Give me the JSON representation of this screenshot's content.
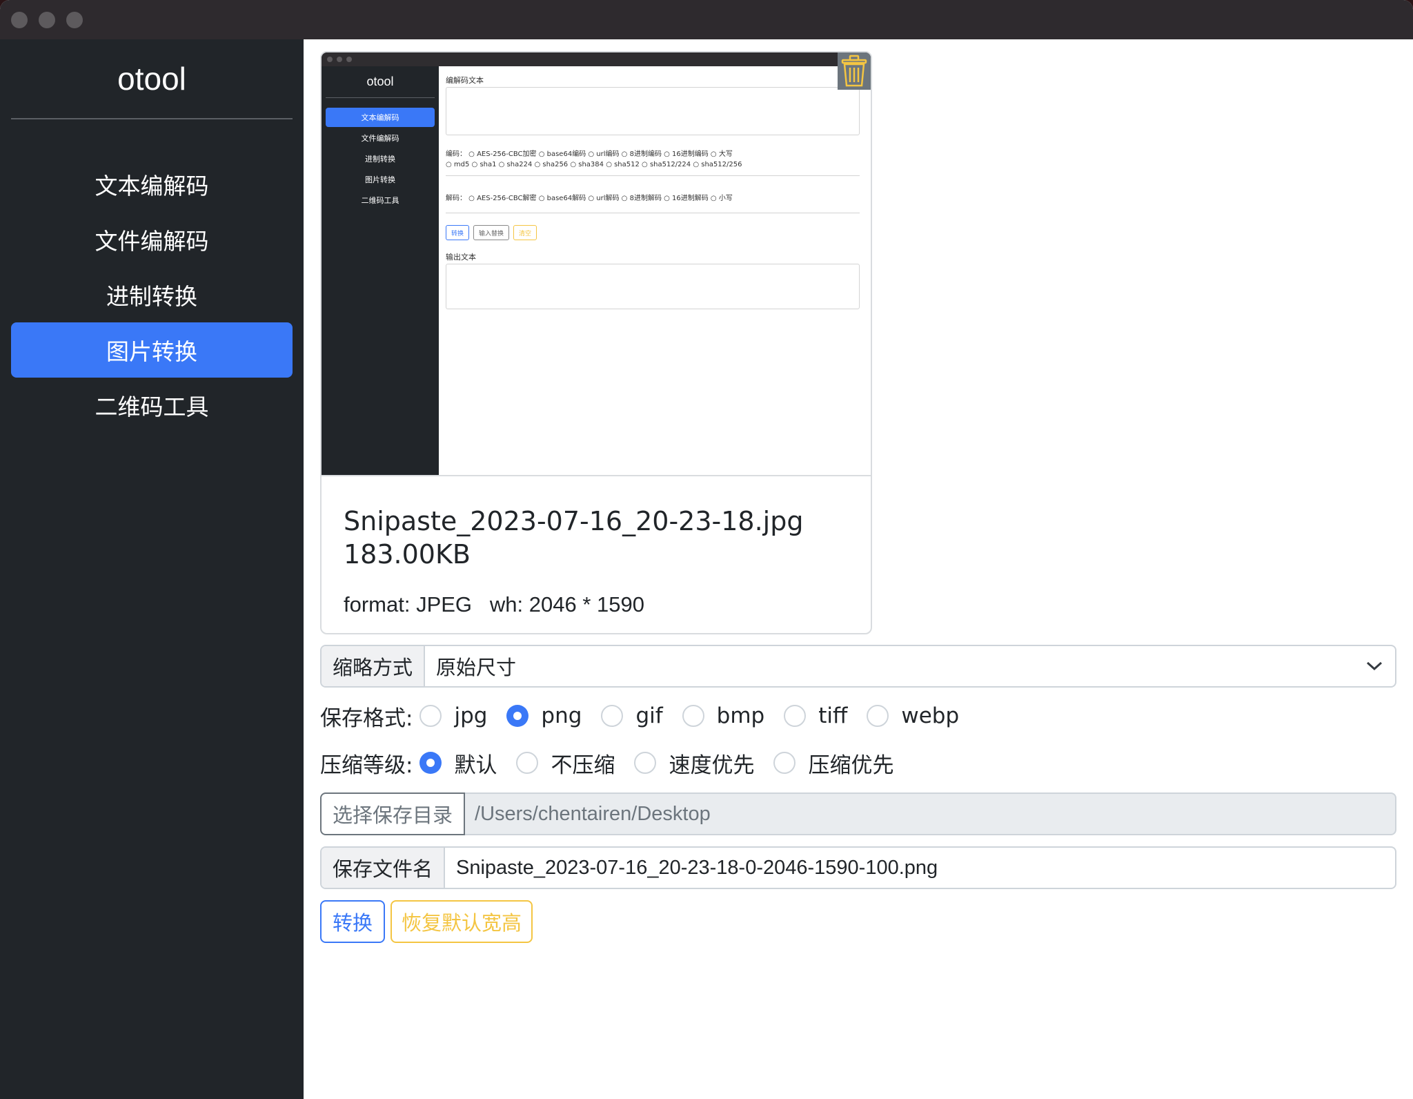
{
  "window": {
    "title_dots": [
      "close",
      "minimize",
      "zoom"
    ]
  },
  "sidebar": {
    "brand": "otool",
    "items": [
      {
        "label": "文本编解码",
        "active": false
      },
      {
        "label": "文件编解码",
        "active": false
      },
      {
        "label": "进制转换",
        "active": false
      },
      {
        "label": "图片转换",
        "active": true
      },
      {
        "label": "二维码工具",
        "active": false
      }
    ]
  },
  "preview": {
    "file_name": "Snipaste_2023-07-16_20-23-18.jpg",
    "file_size": "183.00KB",
    "meta": "format: JPEG   wh: 2046 * 1590",
    "delete_icon": "trash-icon",
    "thumbnail": {
      "brand": "otool",
      "nav": [
        "文本编解码",
        "文件编解码",
        "进制转换",
        "图片转换",
        "二维码工具"
      ],
      "input_label": "编解码文本",
      "encode_line1": "编码：  ○ AES-256-CBC加密  ○ base64编码  ○ url编码  ○ 8进制编码  ○ 16进制编码  ○ 大写",
      "encode_line2": "○ md5  ○ sha1  ○ sha224  ○ sha256  ○ sha384  ○ sha512  ○ sha512/224  ○ sha512/256",
      "decode_line": "解码：  ○ AES-256-CBC解密  ○ base64解码  ○ url解码  ○ 8进制解码  ○ 16进制解码  ○ 小写",
      "buttons": [
        "转换",
        "输入替换",
        "清空"
      ],
      "output_label": "输出文本"
    }
  },
  "resize": {
    "label": "缩略方式",
    "value": "原始尺寸"
  },
  "save_format": {
    "label": "保存格式:",
    "options": [
      "jpg",
      "png",
      "gif",
      "bmp",
      "tiff",
      "webp"
    ],
    "selected": "png"
  },
  "compression": {
    "label": "压缩等级:",
    "options": [
      "默认",
      "不压缩",
      "速度优先",
      "压缩优先"
    ],
    "selected": "默认"
  },
  "save_dir": {
    "button": "选择保存目录",
    "path": "/Users/chentairen/Desktop"
  },
  "save_name": {
    "label": "保存文件名",
    "value": "Snipaste_2023-07-16_20-23-18-0-2046-1590-100.png"
  },
  "actions": {
    "convert": "转换",
    "reset": "恢复默认宽高"
  },
  "colors": {
    "accent": "#3a78f7",
    "warning": "#f4c542",
    "sidebar": "#212529"
  }
}
